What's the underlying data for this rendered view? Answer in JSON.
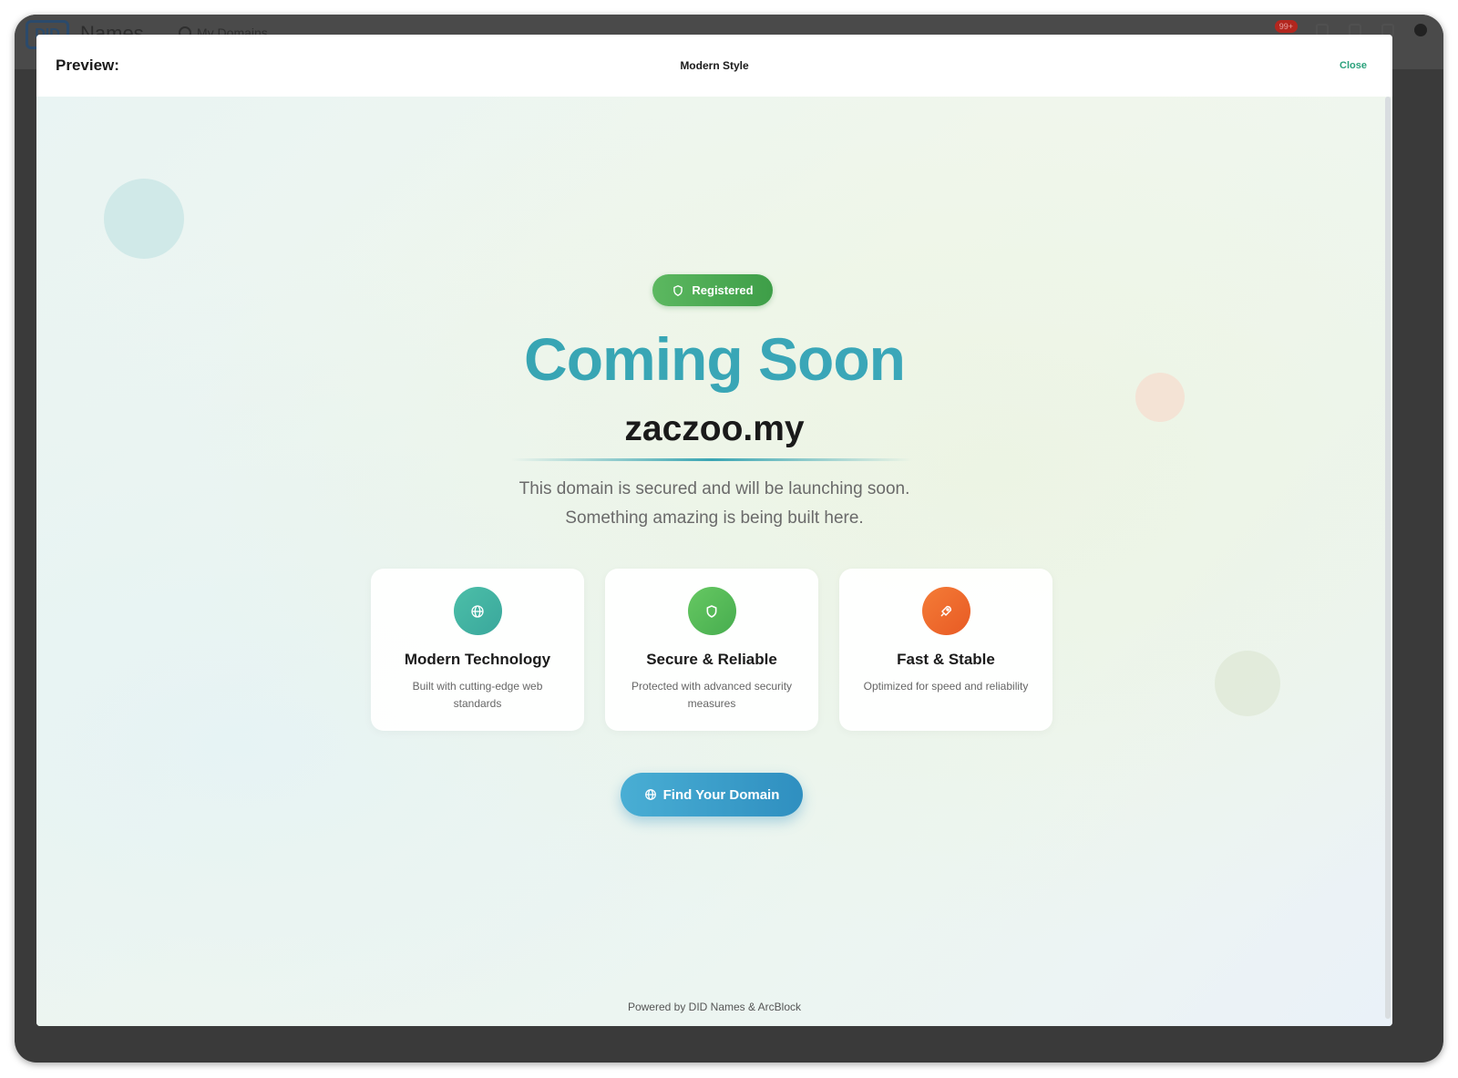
{
  "background_app": {
    "logo": "DID",
    "brand": "Names",
    "nav_item": "My Domains",
    "notification_badge": "99+"
  },
  "modal": {
    "title": "Preview:",
    "style_name": "Modern Style",
    "close_label": "Close"
  },
  "preview": {
    "status_badge": "Registered",
    "headline": "Coming Soon",
    "domain": "zaczoo.my",
    "description_line1": "This domain is secured and will be launching soon.",
    "description_line2": "Something amazing is being built here.",
    "features": [
      {
        "title": "Modern Technology",
        "desc": "Built with cutting-edge web standards",
        "icon": "globe-icon",
        "color": "#4bb8a5"
      },
      {
        "title": "Secure & Reliable",
        "desc": "Protected with advanced security measures",
        "icon": "shield-icon",
        "color": "#5cbf5e"
      },
      {
        "title": "Fast & Stable",
        "desc": "Optimized for speed and reliability",
        "icon": "rocket-icon",
        "color": "#ef6a2f"
      }
    ],
    "cta_label": "Find Your Domain",
    "footer": "Powered by DID Names & ArcBlock"
  },
  "colors": {
    "accent_teal": "#3aa5b3",
    "close_green": "#2aa17b",
    "badge_green": "#4cab52",
    "cta_blue": "#3b9fcb"
  }
}
